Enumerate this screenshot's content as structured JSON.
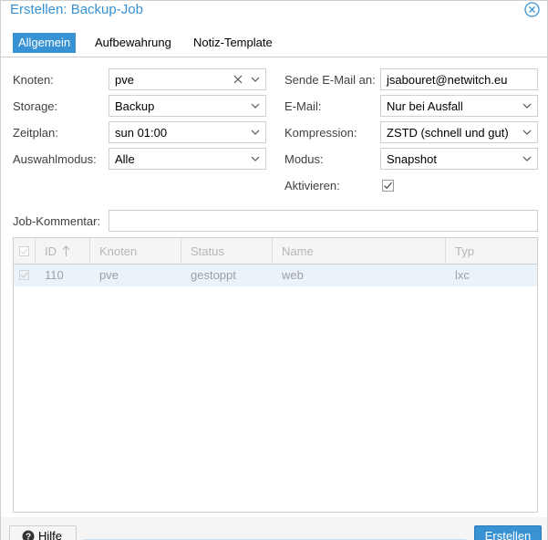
{
  "window": {
    "title": "Erstellen: Backup-Job"
  },
  "tabs": [
    {
      "label": "Allgemein",
      "active": true
    },
    {
      "label": "Aufbewahrung",
      "active": false
    },
    {
      "label": "Notiz-Template",
      "active": false
    }
  ],
  "form": {
    "node": {
      "label": "Knoten:",
      "value": "pve"
    },
    "storage": {
      "label": "Storage:",
      "value": "Backup"
    },
    "schedule": {
      "label": "Zeitplan:",
      "value": "sun 01:00"
    },
    "selection_mode": {
      "label": "Auswahlmodus:",
      "value": "Alle"
    },
    "send_email_to": {
      "label": "Sende E-Mail an:",
      "value": "jsabouret@netwitch.eu"
    },
    "email": {
      "label": "E-Mail:",
      "value": "Nur bei Ausfall"
    },
    "compression": {
      "label": "Kompression:",
      "value": "ZSTD (schnell und gut)"
    },
    "mode": {
      "label": "Modus:",
      "value": "Snapshot"
    },
    "enable": {
      "label": "Aktivieren:",
      "checked": true
    },
    "job_comment": {
      "label": "Job-Kommentar:",
      "value": ""
    }
  },
  "grid": {
    "columns": [
      "ID",
      "Knoten",
      "Status",
      "Name",
      "Typ"
    ],
    "rows": [
      {
        "id": "110",
        "node": "pve",
        "status": "gestoppt",
        "name": "web",
        "type": "lxc"
      }
    ]
  },
  "footer": {
    "help_label": "Hilfe",
    "create_label": "Erstellen"
  },
  "colors": {
    "accent": "#3892d4",
    "border": "#cfcfcf",
    "row_selected": "#eaf2fa"
  },
  "icons": {
    "close": "circle-x-icon",
    "chevron": "chevron-down-icon",
    "clear": "clear-x-icon",
    "help": "question-circle-icon",
    "sort": "arrow-up-icon"
  }
}
